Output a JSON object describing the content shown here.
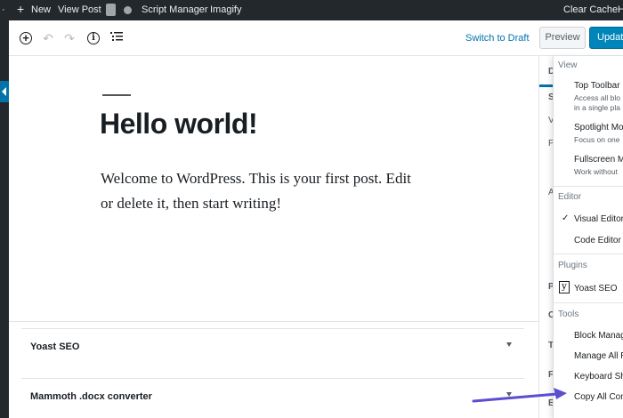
{
  "admin_bar": {
    "new_label": "New",
    "view_post_label": "View Post",
    "script_manager_label": "Script Manager",
    "imagify_label": "Imagify",
    "clear_cache_label": "Clear Cache",
    "trailing_label": "H"
  },
  "toolbar": {
    "switch_to_draft_label": "Switch to Draft",
    "preview_label": "Preview",
    "update_label": "Update"
  },
  "post": {
    "title": "Hello world!",
    "body": "Welcome to WordPress. This is your first post. Edit or delete it, then start writing!"
  },
  "metaboxes": [
    {
      "title": "Yoast SEO"
    },
    {
      "title": "Mammoth .docx converter"
    }
  ],
  "sidebar_letters": [
    "D",
    "S",
    "V",
    "P",
    "A",
    "P",
    "C",
    "T",
    "F",
    "E"
  ],
  "more_menu": {
    "view_heading": "View",
    "top_toolbar": {
      "label": "Top Toolbar",
      "desc_line1": "Access all blo",
      "desc_line2": "in a single pla"
    },
    "spotlight": {
      "label": "Spotlight Mo",
      "desc": "Focus on one"
    },
    "fullscreen": {
      "label": "Fullscreen M",
      "desc": "Work without"
    },
    "editor_heading": "Editor",
    "visual_editor": "Visual Editor",
    "code_editor": "Code Editor",
    "plugins_heading": "Plugins",
    "yoast_seo": "Yoast SEO",
    "tools_heading": "Tools",
    "block_manager": "Block Manag",
    "manage_all": "Manage All R",
    "keyboard": "Keyboard Sh",
    "copy_all": "Copy All Con"
  },
  "colors": {
    "admin_bar": "#23282d",
    "accent": "#0073aa",
    "update_button": "#0085ba",
    "annotation_arrow": "#5b4fcf"
  }
}
